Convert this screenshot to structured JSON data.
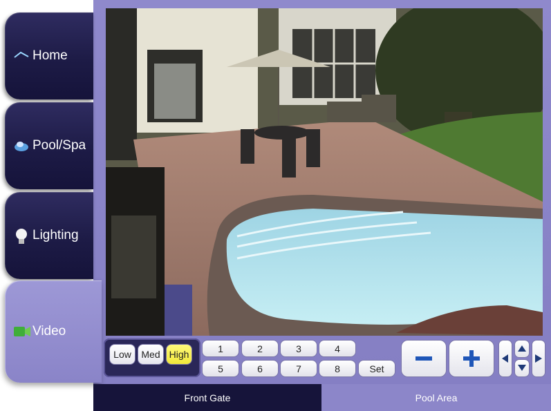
{
  "nav": {
    "items": [
      {
        "label": "Home",
        "icon": "home-icon"
      },
      {
        "label": "Pool/Spa",
        "icon": "pool-icon"
      },
      {
        "label": "Lighting",
        "icon": "bulb-icon"
      },
      {
        "label": "Video",
        "icon": "video-icon"
      }
    ],
    "active": "Video"
  },
  "quality": {
    "buttons": [
      "Low",
      "Med",
      "High"
    ],
    "selected": "High"
  },
  "cameras": {
    "buttons": [
      "1",
      "2",
      "3",
      "4",
      "5",
      "6",
      "7",
      "8"
    ],
    "set_label": "Set"
  },
  "zoom": {
    "out_label": "−",
    "in_label": "+"
  },
  "pan_tilt": {
    "left": "◀",
    "up": "▲",
    "down": "▼",
    "right": "▶"
  },
  "tabs": [
    {
      "label": "Front Gate",
      "active": false
    },
    {
      "label": "Pool Area",
      "active": true
    }
  ],
  "colors": {
    "frame": "#8a84c8",
    "nav_dark": "#1d1b46",
    "selected_quality": "#f1e83a"
  }
}
